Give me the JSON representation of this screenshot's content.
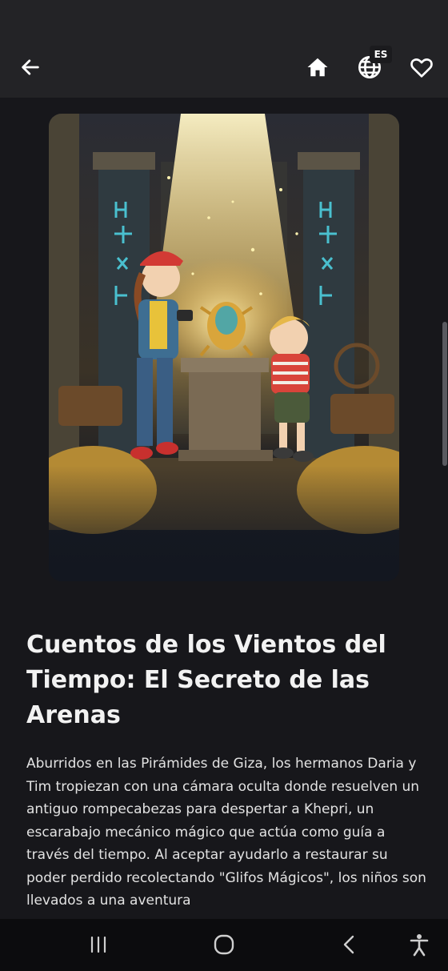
{
  "appbar": {
    "back_icon": "arrow-left-icon",
    "home_icon": "home-icon",
    "language_icon": "globe-icon",
    "language_badge": "ES",
    "favorite_icon": "heart-outline-icon"
  },
  "story": {
    "cover_alt_icon": "cover-illustration",
    "title": "Cuentos de los Vientos del Tiempo: El Secreto de las Arenas",
    "description": "Aburridos en las Pirámides de Giza, los hermanos Daria y Tim tropiezan con una cámara oculta donde resuelven un antiguo rompecabezas para despertar a Khepri, un escarabajo mecánico mágico que actúa como guía a través del tiempo. Al aceptar ayudarlo a restaurar su poder perdido recolectando \"Glifos Mágicos\", los niños son llevados a una aventura"
  },
  "navbar": {
    "recents_icon": "recents-icon",
    "home_icon": "circle-home-icon",
    "back_icon": "chevron-back-icon",
    "accessibility_icon": "accessibility-icon"
  },
  "colors": {
    "background": "#17171b",
    "appbar": "#232326",
    "navbar": "#0c0c0e",
    "text": "#f2f2f2"
  }
}
